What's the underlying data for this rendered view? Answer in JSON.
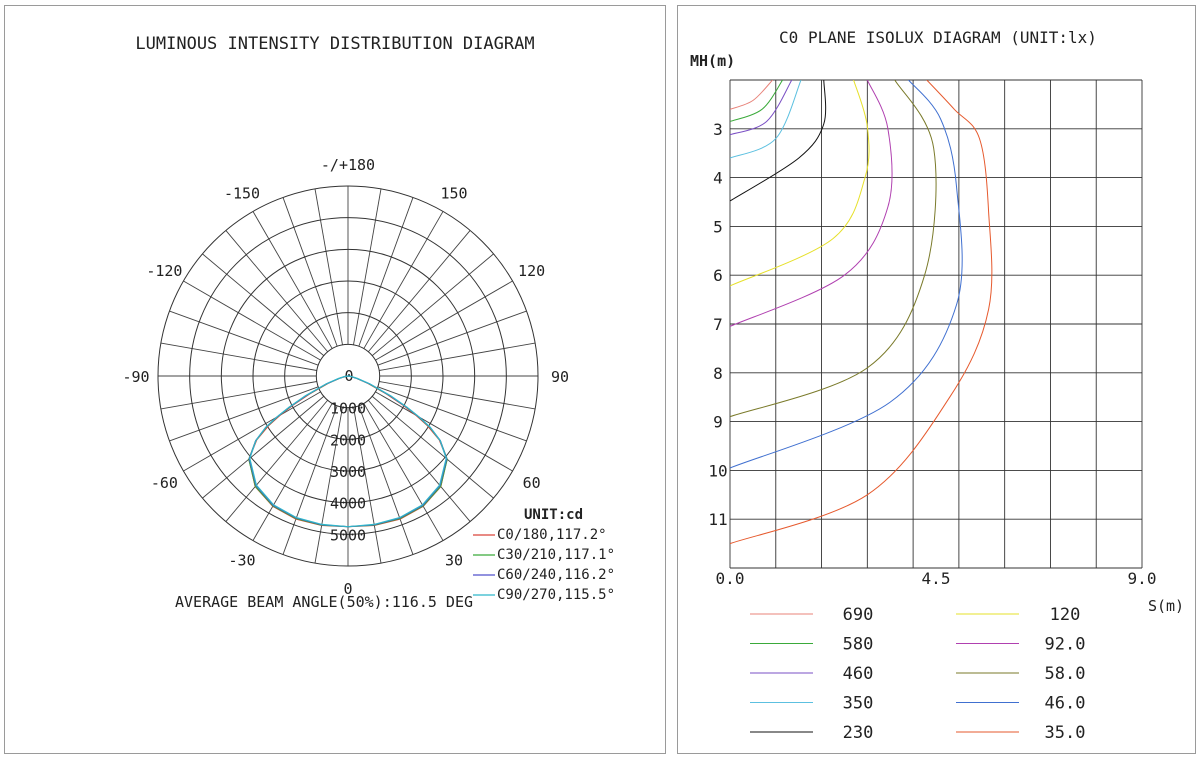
{
  "chart_data": [
    {
      "type": "polar",
      "title": "LUMINOUS INTENSITY DISTRIBUTION DIAGRAM",
      "unit_label": "UNIT:cd",
      "angle_labels": [
        "-/+180",
        "-150",
        "150",
        "-120",
        "120",
        "-90",
        "90",
        "-60",
        "60",
        "-30",
        "30",
        "0"
      ],
      "radial_ticks": [
        0,
        1000,
        2000,
        3000,
        4000,
        5000
      ],
      "radial_tick_labels": [
        "0",
        "1000",
        "2000",
        "3000",
        "4000",
        "5000"
      ],
      "r_max": 6000,
      "angles": [
        0,
        10,
        20,
        30,
        40,
        50,
        55,
        58,
        60,
        62,
        65,
        70,
        75,
        80,
        85,
        90
      ],
      "series": [
        {
          "name": "C0/180,117.2°",
          "color": "#d9443a",
          "values": [
            4760,
            4790,
            4810,
            4750,
            4560,
            4080,
            3520,
            2960,
            2480,
            1980,
            1350,
            640,
            260,
            90,
            25,
            0
          ]
        },
        {
          "name": "C30/210,117.1°",
          "color": "#3aaa3a",
          "values": [
            4760,
            4780,
            4790,
            4740,
            4550,
            4090,
            3560,
            3040,
            2560,
            2080,
            1440,
            700,
            290,
            100,
            30,
            0
          ]
        },
        {
          "name": "C60/240,116.2°",
          "color": "#5050cc",
          "values": [
            4760,
            4770,
            4770,
            4720,
            4520,
            4070,
            3560,
            3060,
            2590,
            2100,
            1470,
            730,
            300,
            105,
            30,
            0
          ]
        },
        {
          "name": "C90/270,115.5°",
          "color": "#2fb7c9",
          "values": [
            4760,
            4760,
            4760,
            4700,
            4500,
            4050,
            3550,
            3060,
            2600,
            2120,
            1490,
            740,
            310,
            110,
            32,
            0
          ]
        }
      ],
      "footer": "AVERAGE BEAM ANGLE(50%):116.5 DEG"
    },
    {
      "type": "line",
      "title": "C0 PLANE ISOLUX DIAGRAM (UNIT:lx)",
      "ylabel": "MH(m)",
      "xlabel": "S(m)",
      "xlim": [
        0,
        9
      ],
      "ylim": [
        2,
        12
      ],
      "x_tick_labels": [
        "0.0",
        "4.5",
        "9.0"
      ],
      "y_tick_labels": [
        "3",
        "4",
        "5",
        "6",
        "7",
        "8",
        "9",
        "10",
        "11"
      ],
      "series": [
        {
          "name": "690",
          "color": "#e8837a",
          "points": [
            [
              0,
              2.6
            ],
            [
              0.5,
              2.42
            ],
            [
              0.93,
              2
            ]
          ]
        },
        {
          "name": "580",
          "color": "#3aaa3a",
          "points": [
            [
              0,
              2.85
            ],
            [
              0.7,
              2.6
            ],
            [
              1.15,
              2
            ]
          ]
        },
        {
          "name": "460",
          "color": "#7a4fc4",
          "points": [
            [
              0,
              3.12
            ],
            [
              0.8,
              2.85
            ],
            [
              1.35,
              2
            ]
          ]
        },
        {
          "name": "350",
          "color": "#5cc0e0",
          "points": [
            [
              0,
              3.6
            ],
            [
              1.0,
              3.2
            ],
            [
              1.55,
              2
            ]
          ]
        },
        {
          "name": "230",
          "color": "#111111",
          "points": [
            [
              0,
              4.48
            ],
            [
              1.5,
              3.6
            ],
            [
              2.05,
              2.9
            ],
            [
              2.05,
              2
            ]
          ]
        },
        {
          "name": "120",
          "color": "#e6e02a",
          "points": [
            [
              0,
              6.22
            ],
            [
              2.25,
              5.25
            ],
            [
              2.95,
              4.0
            ],
            [
              3.0,
              2.95
            ],
            [
              2.7,
              2
            ]
          ]
        },
        {
          "name": "92.0",
          "color": "#b040b0",
          "points": [
            [
              0,
              7.05
            ],
            [
              2.5,
              6.0
            ],
            [
              3.45,
              4.6
            ],
            [
              3.45,
              3.0
            ],
            [
              3.0,
              2
            ]
          ]
        },
        {
          "name": "58.0",
          "color": "#7a7a2a",
          "points": [
            [
              0,
              8.9
            ],
            [
              3.0,
              7.9
            ],
            [
              4.25,
              6.0
            ],
            [
              4.45,
              3.4
            ],
            [
              3.6,
              2
            ]
          ]
        },
        {
          "name": "46.0",
          "color": "#4070d0",
          "points": [
            [
              0,
              9.95
            ],
            [
              3.5,
              8.6
            ],
            [
              4.95,
              6.6
            ],
            [
              4.95,
              4.2
            ],
            [
              4.6,
              2.8
            ],
            [
              3.9,
              2
            ]
          ]
        },
        {
          "name": "35.0",
          "color": "#e65a2e",
          "points": [
            [
              0,
              11.5
            ],
            [
              3.0,
              10.5
            ],
            [
              4.8,
              8.5
            ],
            [
              5.65,
              6.7
            ],
            [
              5.65,
              4.7
            ],
            [
              5.45,
              3.2
            ],
            [
              4.9,
              2.6
            ],
            [
              4.3,
              2
            ]
          ]
        }
      ]
    }
  ]
}
